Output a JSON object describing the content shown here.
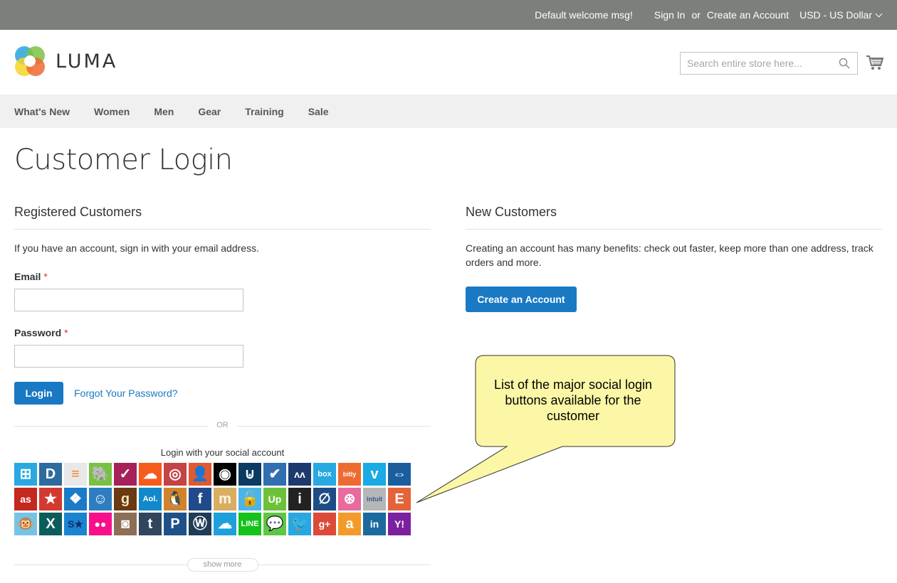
{
  "topbar": {
    "welcome": "Default welcome msg!",
    "sign_in": "Sign In",
    "or": "or",
    "create_account": "Create an Account",
    "currency": "USD - US Dollar"
  },
  "header": {
    "logo_text": "LUMA",
    "search_placeholder": "Search entire store here..."
  },
  "nav": [
    "What's New",
    "Women",
    "Men",
    "Gear",
    "Training",
    "Sale"
  ],
  "page_title": "Customer Login",
  "registered": {
    "title": "Registered Customers",
    "intro": "If you have an account, sign in with your email address.",
    "email_label": "Email",
    "password_label": "Password",
    "required_mark": "*",
    "email_value": "",
    "password_value": "",
    "login_button": "Login",
    "forgot_link": "Forgot Your Password?",
    "or_separator": "OR",
    "social_title": "Login with your social account",
    "show_more": "show more"
  },
  "new_customers": {
    "title": "New Customers",
    "text": "Creating an account has many benefits: check out faster, keep more than one address, track orders and more.",
    "create_button": "Create an Account"
  },
  "callout": {
    "text": "List of the major social login buttons available for the customer",
    "fill": "#fbf7a6"
  },
  "colors": {
    "primary": "#1979c3",
    "topbar_bg": "#7d7f7c",
    "nav_bg": "#f0f0f0",
    "required": "#e02b27"
  },
  "social_providers": [
    {
      "name": "windows",
      "glyph": "⊞",
      "color": "#29a9e0"
    },
    {
      "name": "disqus",
      "glyph": "D",
      "color": "#2e6b9e"
    },
    {
      "name": "stackoverflow",
      "glyph": "≡",
      "color": "#e8e8e8",
      "fg": "#f48024"
    },
    {
      "name": "evernote",
      "glyph": "🐘",
      "color": "#7ac143"
    },
    {
      "name": "foursquare",
      "glyph": "✓",
      "color": "#a6215a"
    },
    {
      "name": "soundcloud",
      "glyph": "☁",
      "color": "#f55b1c"
    },
    {
      "name": "weibo",
      "glyph": "◎",
      "color": "#c44344"
    },
    {
      "name": "persona",
      "glyph": "👤",
      "color": "#e2582f",
      "fg": "#222"
    },
    {
      "name": "github",
      "glyph": "◉",
      "color": "#000000"
    },
    {
      "name": "pocket",
      "glyph": "⊍",
      "color": "#0b3a63"
    },
    {
      "name": "wordpress-com",
      "glyph": "✔",
      "color": "#2f6fb2"
    },
    {
      "name": "mailru",
      "glyph": "ʌʌ",
      "color": "#1c3a6e"
    },
    {
      "name": "box",
      "glyph": "box",
      "color": "#27a9e1"
    },
    {
      "name": "bitly",
      "glyph": "bitly",
      "color": "#ed6b31"
    },
    {
      "name": "vimeo",
      "glyph": "v",
      "color": "#1aaae4"
    },
    {
      "name": "teamviewer",
      "glyph": "⇔",
      "color": "#1a5e9e"
    },
    {
      "name": "lastfm",
      "glyph": "as",
      "color": "#c3291c"
    },
    {
      "name": "odnoklassniki",
      "glyph": "★",
      "color": "#d33a2f"
    },
    {
      "name": "dropbox",
      "glyph": "❖",
      "color": "#1b7bc6"
    },
    {
      "name": "reddit",
      "glyph": "☺",
      "color": "#2f7dc1"
    },
    {
      "name": "goodreads",
      "glyph": "g",
      "color": "#6b3a10",
      "fg": "#f4e3c1"
    },
    {
      "name": "aol",
      "glyph": "Aol.",
      "color": "#1188c9"
    },
    {
      "name": "qq",
      "glyph": "🐧",
      "color": "#d1832b"
    },
    {
      "name": "facebook",
      "glyph": "f",
      "color": "#214a8c"
    },
    {
      "name": "meetup",
      "glyph": "m",
      "color": "#d9ae63",
      "fg": "#fff7e6"
    },
    {
      "name": "auth0",
      "glyph": "🔓",
      "color": "#4ab6e8"
    },
    {
      "name": "upwork",
      "glyph": "Up",
      "color": "#6bc23a"
    },
    {
      "name": "instapaper",
      "glyph": "i",
      "color": "#222222"
    },
    {
      "name": "salesforce-chatter",
      "glyph": "∅",
      "color": "#1c4d85"
    },
    {
      "name": "dribbble",
      "glyph": "⊛",
      "color": "#e86a9e"
    },
    {
      "name": "intuit",
      "glyph": "intuit",
      "color": "#b6b6b6",
      "fg": "#2f5a9c"
    },
    {
      "name": "etsy",
      "glyph": "E",
      "color": "#e5633a"
    },
    {
      "name": "mailchimp",
      "glyph": "🐵",
      "color": "#76c3e8"
    },
    {
      "name": "xing",
      "glyph": "X",
      "color": "#0a5d5a"
    },
    {
      "name": "stackexchange",
      "glyph": "S★",
      "color": "#1a84d1",
      "fg": "#0f2f66"
    },
    {
      "name": "flickr",
      "glyph": "●●",
      "color": "#f8108a"
    },
    {
      "name": "instagram",
      "glyph": "◙",
      "color": "#8d6e57"
    },
    {
      "name": "tumblr",
      "glyph": "t",
      "color": "#31465d"
    },
    {
      "name": "paypal",
      "glyph": "P",
      "color": "#1e5189"
    },
    {
      "name": "wordpress",
      "glyph": "Ⓦ",
      "color": "#1f3c56"
    },
    {
      "name": "salesforce",
      "glyph": "☁",
      "color": "#1ea0dc"
    },
    {
      "name": "line",
      "glyph": "LINE",
      "color": "#15c21a"
    },
    {
      "name": "wechat",
      "glyph": "💬",
      "color": "#5ec645"
    },
    {
      "name": "twitter",
      "glyph": "🐦",
      "color": "#2aa6e0"
    },
    {
      "name": "google-plus",
      "glyph": "g+",
      "color": "#dc4a38"
    },
    {
      "name": "amazon",
      "glyph": "a",
      "color": "#f39a28"
    },
    {
      "name": "linkedin",
      "glyph": "in",
      "color": "#1a6aa0"
    },
    {
      "name": "yahoo",
      "glyph": "Y!",
      "color": "#7b209f"
    }
  ]
}
